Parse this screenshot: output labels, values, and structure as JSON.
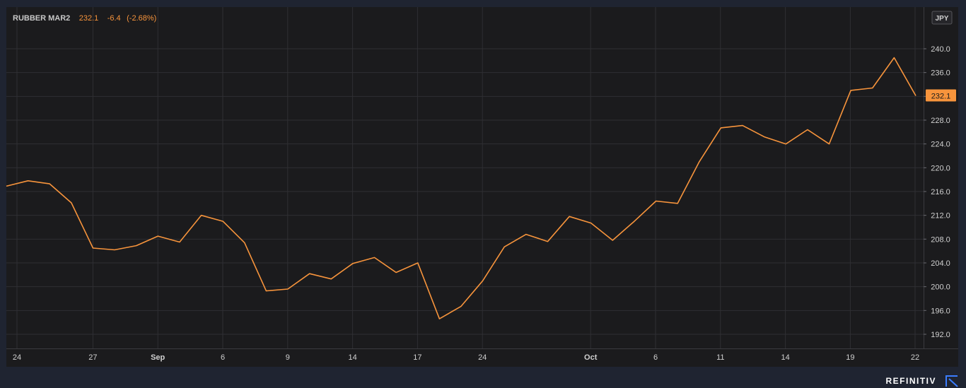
{
  "legend": {
    "symbol": "RUBBER MAR2",
    "last": "232.1",
    "change": "-6.4",
    "change_pct": "(-2.68%)"
  },
  "currency": "JPY",
  "brand": "REFINITIV",
  "colors": {
    "background": "#1f2431",
    "plot_background": "#1b1b1d",
    "line": "#f7943c",
    "grid": "#2f2f33",
    "price_tag": "#f7943c"
  },
  "chart_data": {
    "type": "line",
    "title": "",
    "xlabel": "",
    "ylabel": "",
    "ylim": [
      190,
      246
    ],
    "y_ticks": [
      "192.0",
      "196.0",
      "200.0",
      "204.0",
      "208.0",
      "212.0",
      "216.0",
      "220.0",
      "224.0",
      "228.0",
      "232.0",
      "236.0",
      "240.0"
    ],
    "x_ticks": [
      {
        "label": "24",
        "date": "Aug 24",
        "bold": false
      },
      {
        "label": "27",
        "date": "Aug 27",
        "bold": false
      },
      {
        "label": "Sep",
        "date": "Sep 1",
        "bold": true
      },
      {
        "label": "6",
        "date": "Sep 6",
        "bold": false
      },
      {
        "label": "9",
        "date": "Sep 9",
        "bold": false
      },
      {
        "label": "14",
        "date": "Sep 14",
        "bold": false
      },
      {
        "label": "17",
        "date": "Sep 17",
        "bold": false
      },
      {
        "label": "24",
        "date": "Sep 24",
        "bold": false
      },
      {
        "label": "Oct",
        "date": "Oct 1",
        "bold": true
      },
      {
        "label": "6",
        "date": "Oct 6",
        "bold": false
      },
      {
        "label": "11",
        "date": "Oct 11",
        "bold": false
      },
      {
        "label": "14",
        "date": "Oct 14",
        "bold": false
      },
      {
        "label": "19",
        "date": "Oct 19",
        "bold": false
      },
      {
        "label": "22",
        "date": "Oct 22",
        "bold": false
      }
    ],
    "grid": true,
    "current_value": "232.1",
    "series": [
      {
        "x": [
          "Aug 23",
          "Aug 24",
          "Aug 25",
          "Aug 26",
          "Aug 27",
          "Aug 30",
          "Aug 31",
          "Sep 1",
          "Sep 2",
          "Sep 3",
          "Sep 6",
          "Sep 7",
          "Sep 8",
          "Sep 9",
          "Sep 10",
          "Sep 13",
          "Sep 14",
          "Sep 15",
          "Sep 16",
          "Sep 17",
          "Sep 21",
          "Sep 22",
          "Sep 24",
          "Sep 27",
          "Sep 28",
          "Sep 29",
          "Sep 30",
          "Oct 1",
          "Oct 4",
          "Oct 5",
          "Oct 6",
          "Oct 7",
          "Oct 8",
          "Oct 11",
          "Oct 12",
          "Oct 13",
          "Oct 14",
          "Oct 15",
          "Oct 18",
          "Oct 19",
          "Oct 20",
          "Oct 21",
          "Oct 22"
        ],
        "values": [
          216.9,
          217.8,
          217.3,
          214.1,
          206.5,
          206.2,
          206.9,
          208.5,
          207.5,
          212.0,
          211.0,
          207.4,
          199.3,
          199.6,
          202.2,
          201.3,
          203.9,
          204.9,
          202.4,
          204.0,
          194.6,
          196.7,
          201.0,
          206.7,
          208.8,
          207.6,
          211.8,
          210.7,
          207.8,
          211.0,
          214.4,
          214.0,
          221.0,
          226.7,
          227.1,
          225.2,
          224.0,
          226.4,
          224.0,
          233.0,
          233.4,
          238.5,
          232.1
        ]
      }
    ]
  }
}
